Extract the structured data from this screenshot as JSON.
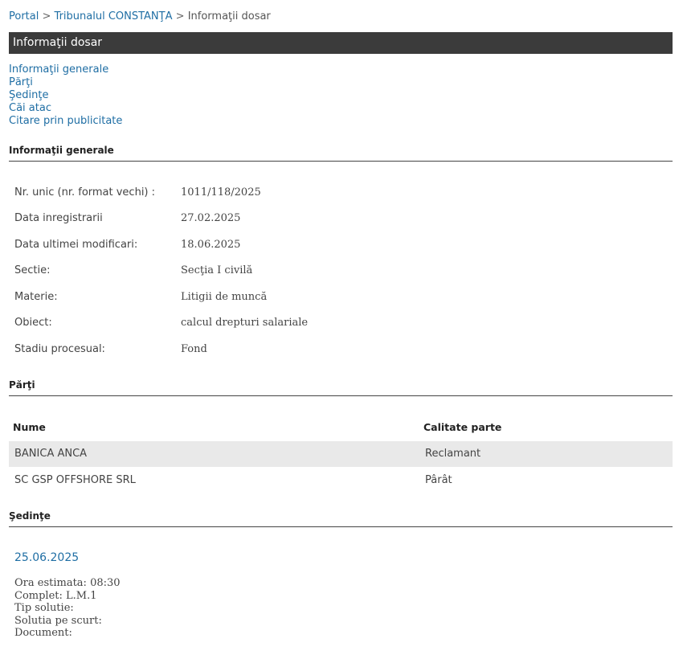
{
  "breadcrumb": {
    "items": [
      "Portal",
      "Tribunalul CONSTANŢA",
      "Informaţii dosar"
    ],
    "separator": ">"
  },
  "header": {
    "title": "Informaţii dosar"
  },
  "toc": [
    "Informaţii generale",
    "Părţi",
    "Şedinţe",
    "Căi atac",
    "Citare prin publicitate"
  ],
  "general": {
    "title": "Informaţii generale",
    "rows": [
      {
        "label": "Nr. unic (nr. format vechi) :",
        "value": "1011/118/2025"
      },
      {
        "label": "Data inregistrarii",
        "value": "27.02.2025"
      },
      {
        "label": "Data ultimei modificari:",
        "value": "18.06.2025"
      },
      {
        "label": "Sectie:",
        "value": "Secţia I civilă"
      },
      {
        "label": "Materie:",
        "value": "Litigii de muncă"
      },
      {
        "label": "Obiect:",
        "value": "calcul drepturi salariale"
      },
      {
        "label": "Stadiu procesual:",
        "value": "Fond"
      }
    ]
  },
  "parti": {
    "title": "Părţi",
    "columns": [
      "Nume",
      "Calitate parte"
    ],
    "rows": [
      {
        "nume": "BANICA ANCA",
        "calitate": "Reclamant"
      },
      {
        "nume": "SC GSP OFFSHORE SRL",
        "calitate": "Pârât"
      }
    ]
  },
  "sedinte": {
    "title": "Şedinţe",
    "date": "25.06.2025",
    "lines": [
      "Ora estimata: 08:30",
      "Complet: L.M.1",
      "Tip solutie:",
      "Solutia pe scurt:",
      "Document:"
    ]
  },
  "colors": {
    "link": "#1f6ea4",
    "header_bg": "#3b3b3b",
    "row_alt": "#e9e9e9"
  }
}
